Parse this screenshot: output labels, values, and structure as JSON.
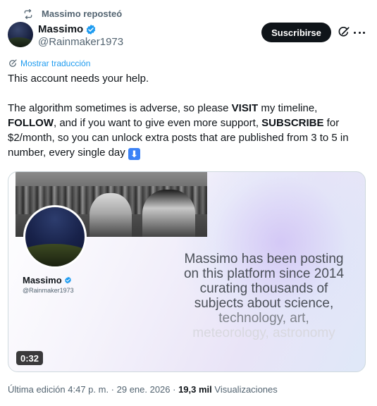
{
  "repost": {
    "label": "Massimo reposteó",
    "icon": "repost-icon"
  },
  "author": {
    "name": "Massimo",
    "handle": "@Rainmaker1973",
    "verified": true,
    "verified_color": "#1d9bf0"
  },
  "actions": {
    "subscribe_label": "Suscribirse"
  },
  "translate_label": "Mostrar traducción",
  "tweet": {
    "line1": "This account needs your help.",
    "p2_a": "The algorithm sometimes is adverse, so please ",
    "p2_visit": "VISIT",
    "p2_b": " my timeline,",
    "p2_follow": "FOLLOW",
    "p2_c": ", and if you want to give even more support, ",
    "p2_subscribe": "SUBSCRIBE",
    "p2_d": " for $2/month, so you can unlock extra posts that are published from 3 to 5 in number, every single day",
    "emoji": "⬇"
  },
  "media": {
    "card_name": "Massimo",
    "card_handle": "@Rainmaker1973",
    "overlay_lines": [
      "Massimo has been posting",
      "on this platform since 2014",
      "curating thousands of",
      "subjects about science,",
      "technology, art,",
      "meteorology, astronomy"
    ],
    "duration": "0:32"
  },
  "meta": {
    "edited": "Última edición 4:47 p. m. · 29 ene. 2026 · ",
    "views_count": "19,3 mil",
    "views_label": " Visualizaciones"
  },
  "colors": {
    "accent": "#1d9bf0",
    "text": "#0f1419",
    "muted": "#536471"
  }
}
